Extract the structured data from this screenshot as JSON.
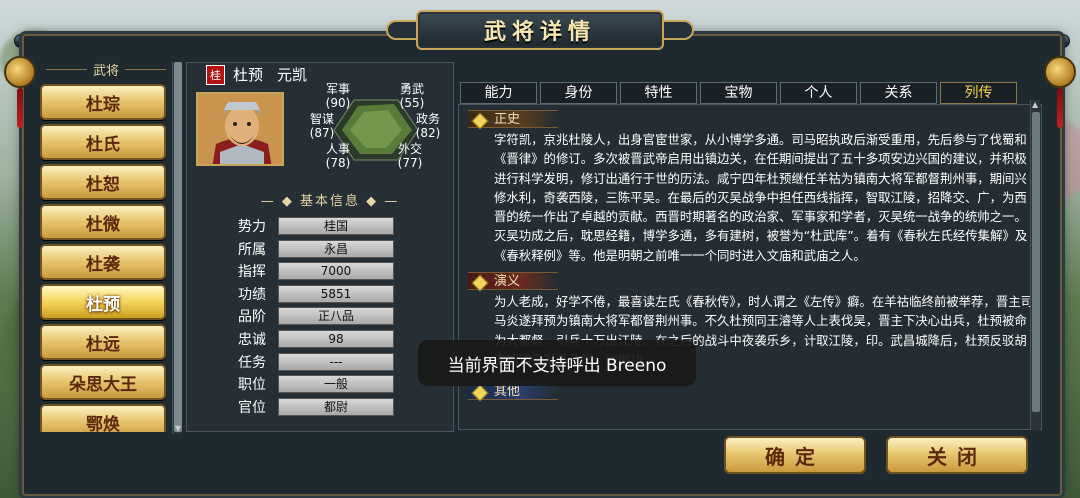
{
  "window": {
    "title": "武将详情"
  },
  "sidebar": {
    "header": "武将",
    "items": [
      "杜琮",
      "杜氏",
      "杜恕",
      "杜微",
      "杜袭",
      "杜预",
      "杜远",
      "朵思大王",
      "鄂焕"
    ],
    "selected": "杜预"
  },
  "general": {
    "faction_tag": "桂",
    "name": "杜预",
    "courtesy": "元凯"
  },
  "stats": {
    "military": {
      "label": "军事",
      "value": "(90)"
    },
    "valor": {
      "label": "勇武",
      "value": "(55)"
    },
    "strategy": {
      "label": "智谋",
      "value": "(87)"
    },
    "politics": {
      "label": "政务",
      "value": "(82)"
    },
    "personnel": {
      "label": "人事",
      "value": "(78)"
    },
    "diplomacy": {
      "label": "外交",
      "value": "(77)"
    }
  },
  "basic_info": {
    "header": "基本信息",
    "rows": [
      {
        "label": "势力",
        "value": "桂国"
      },
      {
        "label": "所属",
        "value": "永昌"
      },
      {
        "label": "指挥",
        "value": "7000"
      },
      {
        "label": "功绩",
        "value": "5851"
      },
      {
        "label": "品阶",
        "value": "正八品"
      },
      {
        "label": "忠诚",
        "value": "98"
      },
      {
        "label": "任务",
        "value": "---"
      },
      {
        "label": "职位",
        "value": "一般"
      },
      {
        "label": "官位",
        "value": "都尉"
      }
    ]
  },
  "tabs": [
    "能力",
    "身份",
    "特性",
    "宝物",
    "个人",
    "关系",
    "列传"
  ],
  "selected_tab": "列传",
  "biography": {
    "sections": [
      {
        "title": "正史",
        "text": "字符凯，京兆杜陵人，出身官宦世家，从小博学多通。司马昭执政后渐受重用，先后参与了伐蜀和《晋律》的修订。多次被晋武帝启用出镇边关，在任期间提出了五十多项安边兴国的建议，并积极进行科学发明，修订出通行于世的历法。咸宁四年杜预继任羊祜为镇南大将军都督荆州事，期间兴修水利，奇袭西陵，三陈平吴。在最后的灭吴战争中担任西线指挥，智取江陵，招降交、广，为西晋的统一作出了卓越的贡献。西晋时期著名的政治家、军事家和学者，灭吴统一战争的统帅之一。灭吴功成之后，耽思经籍，博学多通，多有建树，被誉为“杜武库”。着有《春秋左氏经传集解》及《春秋释例》等。他是明朝之前唯一一个同时进入文庙和武庙之人。"
      },
      {
        "title": "演义",
        "text": "为人老成，好学不倦，最喜读左氏《春秋传》，时人谓之《左传》癖。在羊祜临终前被举荐，晋主司马炎遂拜预为镇南大将军都督荆州事。不久杜预同王濬等人上表伐吴，晋主下决心出兵，杜预被命为大都督，引兵十万出江陵。在之后的战斗中夜袭乐乡，计取江陵，印。武昌城降后，杜预反驳胡奋的消极军事政策，驰檄功。"
      },
      {
        "title": "其他",
        "text": ""
      }
    ]
  },
  "buttons": {
    "confirm": "确定",
    "close": "关闭"
  },
  "toast": {
    "text": "当前界面不支持呼出 Breeno"
  }
}
